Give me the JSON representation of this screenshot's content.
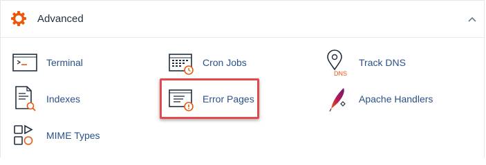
{
  "section": {
    "title": "Advanced",
    "icon": "gear-icon",
    "collapse_icon": "chevron-up-icon",
    "accent_color": "#e8590c"
  },
  "items": [
    {
      "label": "Terminal",
      "icon": "terminal-icon"
    },
    {
      "label": "Cron Jobs",
      "icon": "calendar-clock-icon"
    },
    {
      "label": "Track DNS",
      "icon": "map-pin-dns-icon",
      "icon_text": "DNS"
    },
    {
      "label": "Indexes",
      "icon": "document-search-icon"
    },
    {
      "label": "Error Pages",
      "icon": "document-warning-icon",
      "highlighted": true
    },
    {
      "label": "Apache Handlers",
      "icon": "apache-feather-icon"
    },
    {
      "label": "MIME Types",
      "icon": "shapes-icon"
    }
  ],
  "highlight_color": "#e04b4d"
}
